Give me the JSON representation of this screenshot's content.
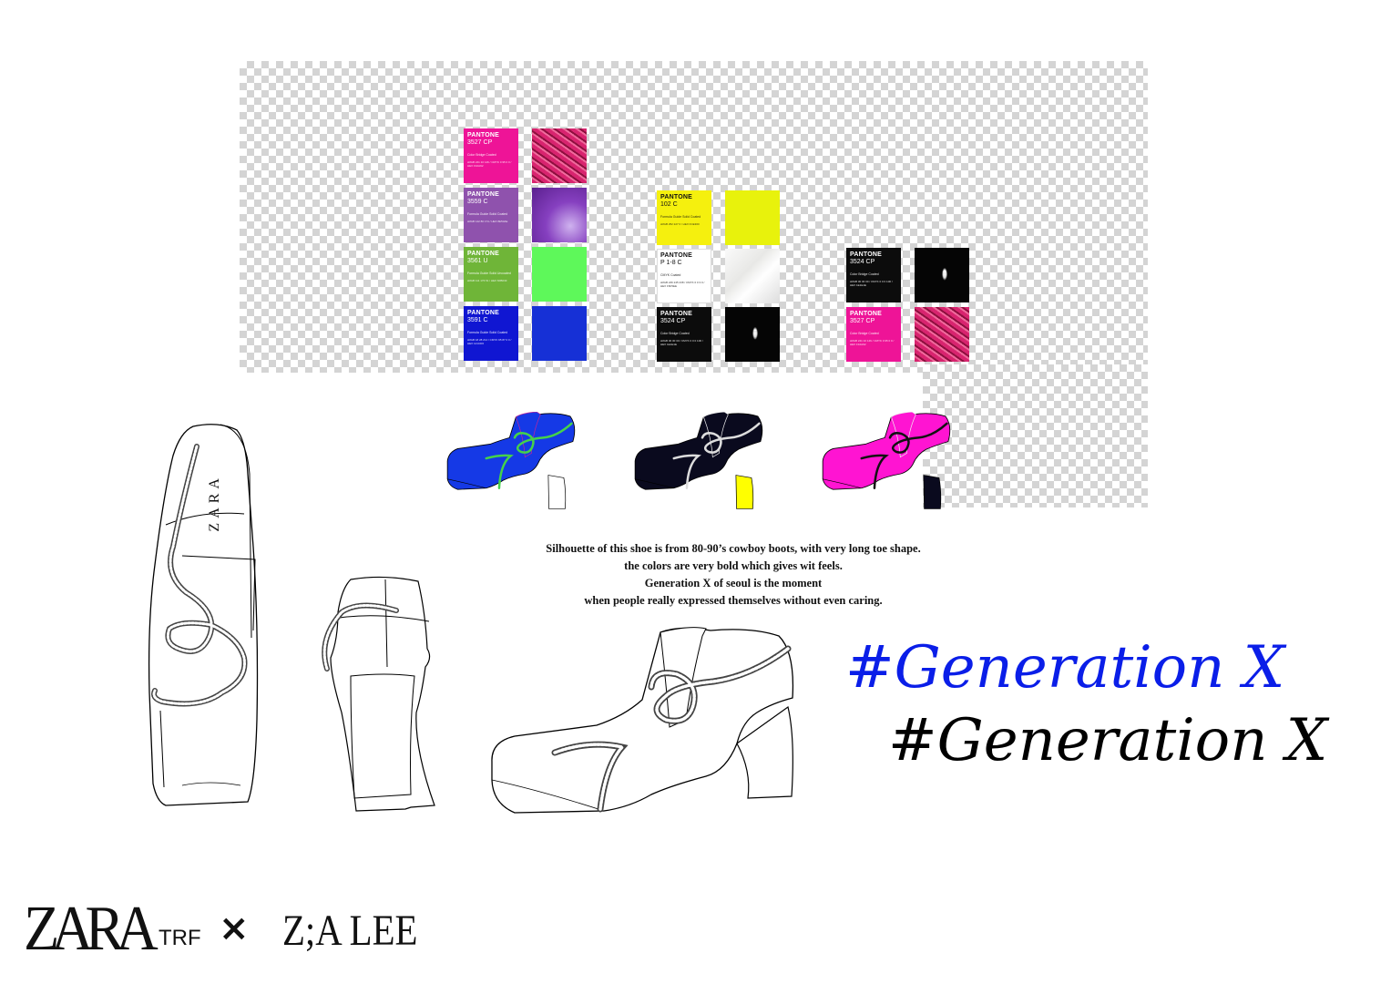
{
  "palette": {
    "column1": [
      {
        "brand": "PANTONE",
        "code": "3527 CP",
        "desc": "Color Bridge Coated",
        "spec": "sRGB  241 10 146 / CMYK  0 95 0 0 / HEX  F10A92",
        "chip_color": "#ee1497",
        "swatch_color": "#d8246f",
        "swatch_texture": "ruffled-fabric"
      },
      {
        "brand": "PANTONE",
        "code": "3559 C",
        "desc": "Formula Guide Solid Coated",
        "spec": "sRGB  142 80 174 / HEX  8E50AE",
        "chip_color": "#8f52ad",
        "swatch_color": "#8640c0",
        "swatch_texture": "metallic"
      },
      {
        "brand": "PANTONE",
        "code": "3561 U",
        "desc": "Formula Guide Solid Uncoated",
        "spec": "sRGB  111 176 51 / HEX  6FB033",
        "chip_color": "#6fb538",
        "swatch_color": "#5ef85a",
        "swatch_texture": "flat"
      },
      {
        "brand": "PANTONE",
        "code": "3591 C",
        "desc": "Formula Guide Solid Coated",
        "spec": "sRGB  18 28 214 / CMYK  95 87 0 0 / HEX  121CD6",
        "chip_color": "#1016d2",
        "swatch_color": "#1630d6",
        "swatch_texture": "flat"
      }
    ],
    "column2": [
      {
        "brand": "PANTONE",
        "code": "102 C",
        "desc": "Formula Guide Solid Coated",
        "spec": "sRGB  252 227 0 / HEX  FCE300",
        "chip_color": "#f5f00e",
        "swatch_color": "#e8f20c",
        "swatch_texture": "flat",
        "light": true
      },
      {
        "brand": "PANTONE",
        "code": "P 1-8 C",
        "desc": "CMYK Coated",
        "spec": "sRGB  246 245 238 / CMYK  0 0 3 0 / HEX  F6F5EE",
        "chip_color": "#ffffff",
        "swatch_color": "#e8e8e6",
        "swatch_texture": "marble",
        "light": true
      },
      {
        "brand": "PANTONE",
        "code": "3524 CP",
        "desc": "Color Bridge Coated",
        "spec": "sRGB  30 30 30 / CMYK  0 0 0 100 / HEX  1E1E1E",
        "chip_color": "#0c0c0c",
        "swatch_color": "#050505",
        "swatch_texture": "gloss"
      }
    ],
    "column3": [
      {
        "brand": "PANTONE",
        "code": "3524 CP",
        "desc": "Color Bridge Coated",
        "spec": "sRGB  30 30 30 / CMYK  0 0 0 100 / HEX  1E1E1E",
        "chip_color": "#0c0c0c",
        "swatch_color": "#050505",
        "swatch_texture": "gloss"
      },
      {
        "brand": "PANTONE",
        "code": "3527 CP",
        "desc": "Color Bridge Coated",
        "spec": "sRGB  241 10 146 / CMYK  0 95 0 0 / HEX  F10A92",
        "chip_color": "#ee1497",
        "swatch_color": "#d8246f",
        "swatch_texture": "ruffled-fabric"
      }
    ]
  },
  "colorways": [
    {
      "name": "blue",
      "upper": "#1539e6",
      "rope": "#45d24a",
      "trim": "#c2269a",
      "heel": "#ffffff"
    },
    {
      "name": "black",
      "upper": "#0a0a1e",
      "rope": "#dddddd",
      "trim": "#eeeeee",
      "heel": "#ffff00"
    },
    {
      "name": "pink",
      "upper": "#ff14d2",
      "rope": "#111111",
      "trim": "#eeeeee",
      "heel": "#0a0a1e"
    }
  ],
  "caption": {
    "line1": "Silhouette of this shoe is from 80-90’s cowboy boots, with very long toe shape.",
    "line2": "the colors are very bold which gives wit feels.",
    "line3": "Generation X of seoul is the moment",
    "line4": "when people really expressed themselves without even caring."
  },
  "insole_logo": "ZARA",
  "hashtag": {
    "primary": "#Generation X",
    "secondary": "#Generation X",
    "primary_color": "#0a1ee8",
    "secondary_color": "#000000"
  },
  "footer": {
    "brand": "ZARA",
    "sub_brand": "TRF",
    "cross": "×",
    "collab": "Z;A LEE"
  }
}
